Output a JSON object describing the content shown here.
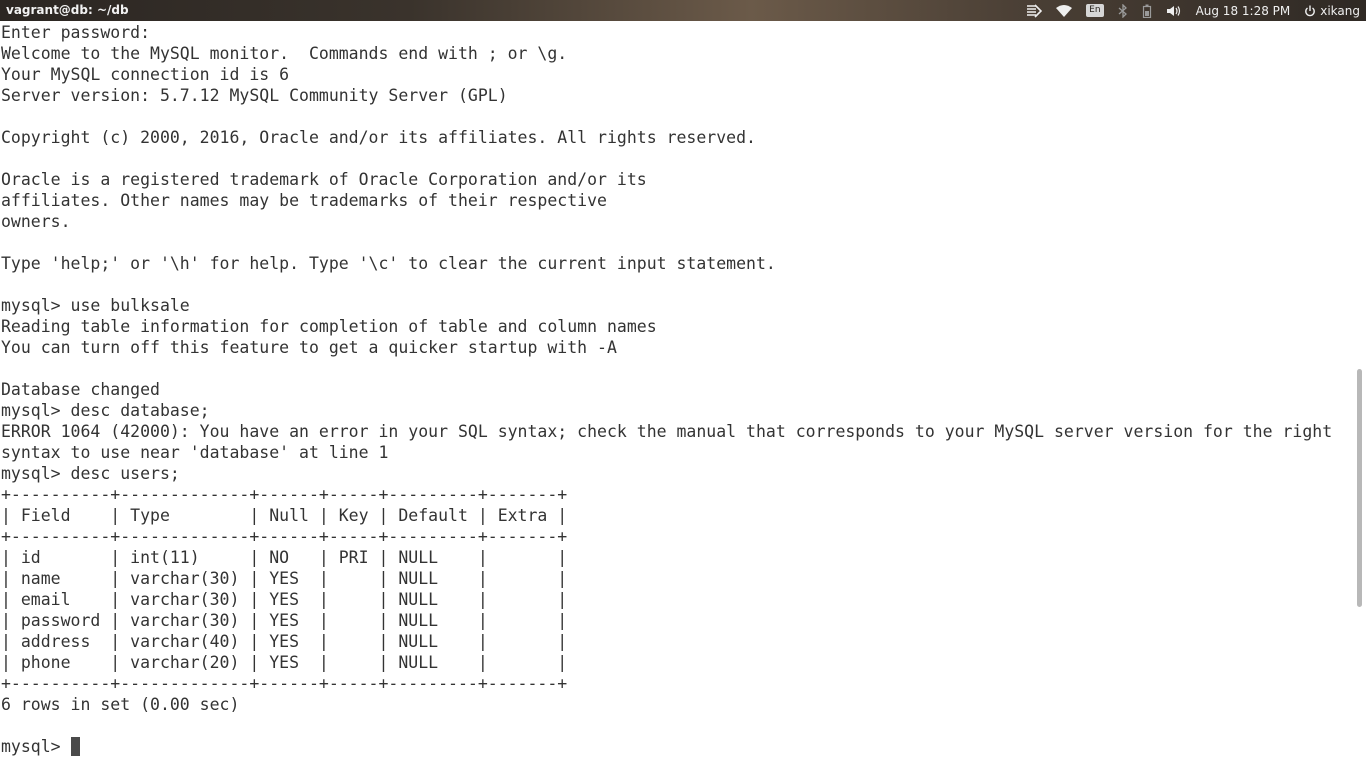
{
  "topbar": {
    "window_title": "vagrant@db: ~/db",
    "keyboard_layout": "En",
    "datetime": "Aug 18  1:28 PM",
    "user": "xikang",
    "icons": [
      "network-icon",
      "wifi-icon",
      "keyboard-layout-icon",
      "bluetooth-icon",
      "battery-icon",
      "volume-icon",
      "power-icon"
    ]
  },
  "terminal": {
    "lines": [
      "Enter password:",
      "Welcome to the MySQL monitor.  Commands end with ; or \\g.",
      "Your MySQL connection id is 6",
      "Server version: 5.7.12 MySQL Community Server (GPL)",
      "",
      "Copyright (c) 2000, 2016, Oracle and/or its affiliates. All rights reserved.",
      "",
      "Oracle is a registered trademark of Oracle Corporation and/or its",
      "affiliates. Other names may be trademarks of their respective",
      "owners.",
      "",
      "Type 'help;' or '\\h' for help. Type '\\c' to clear the current input statement.",
      "",
      "mysql> use bulksale",
      "Reading table information for completion of table and column names",
      "You can turn off this feature to get a quicker startup with -A",
      "",
      "Database changed",
      "mysql> desc database;",
      "ERROR 1064 (42000): You have an error in your SQL syntax; check the manual that corresponds to your MySQL server version for the right",
      "syntax to use near 'database' at line 1",
      "mysql> desc users;",
      "+----------+-------------+------+-----+---------+-------+",
      "| Field    | Type        | Null | Key | Default | Extra |",
      "+----------+-------------+------+-----+---------+-------+",
      "| id       | int(11)     | NO   | PRI | NULL    |       |",
      "| name     | varchar(30) | YES  |     | NULL    |       |",
      "| email    | varchar(30) | YES  |     | NULL    |       |",
      "| password | varchar(30) | YES  |     | NULL    |       |",
      "| address  | varchar(40) | YES  |     | NULL    |       |",
      "| phone    | varchar(20) | YES  |     | NULL    |       |",
      "+----------+-------------+------+-----+---------+-------+",
      "6 rows in set (0.00 sec)",
      ""
    ],
    "prompt": "mysql> ",
    "input_value": ""
  },
  "scrollbar": {
    "position_fraction": 0.69
  },
  "colors": {
    "terminal_background": "#ffffff",
    "terminal_text": "#333333",
    "topbar_text": "#f2f2f2"
  }
}
